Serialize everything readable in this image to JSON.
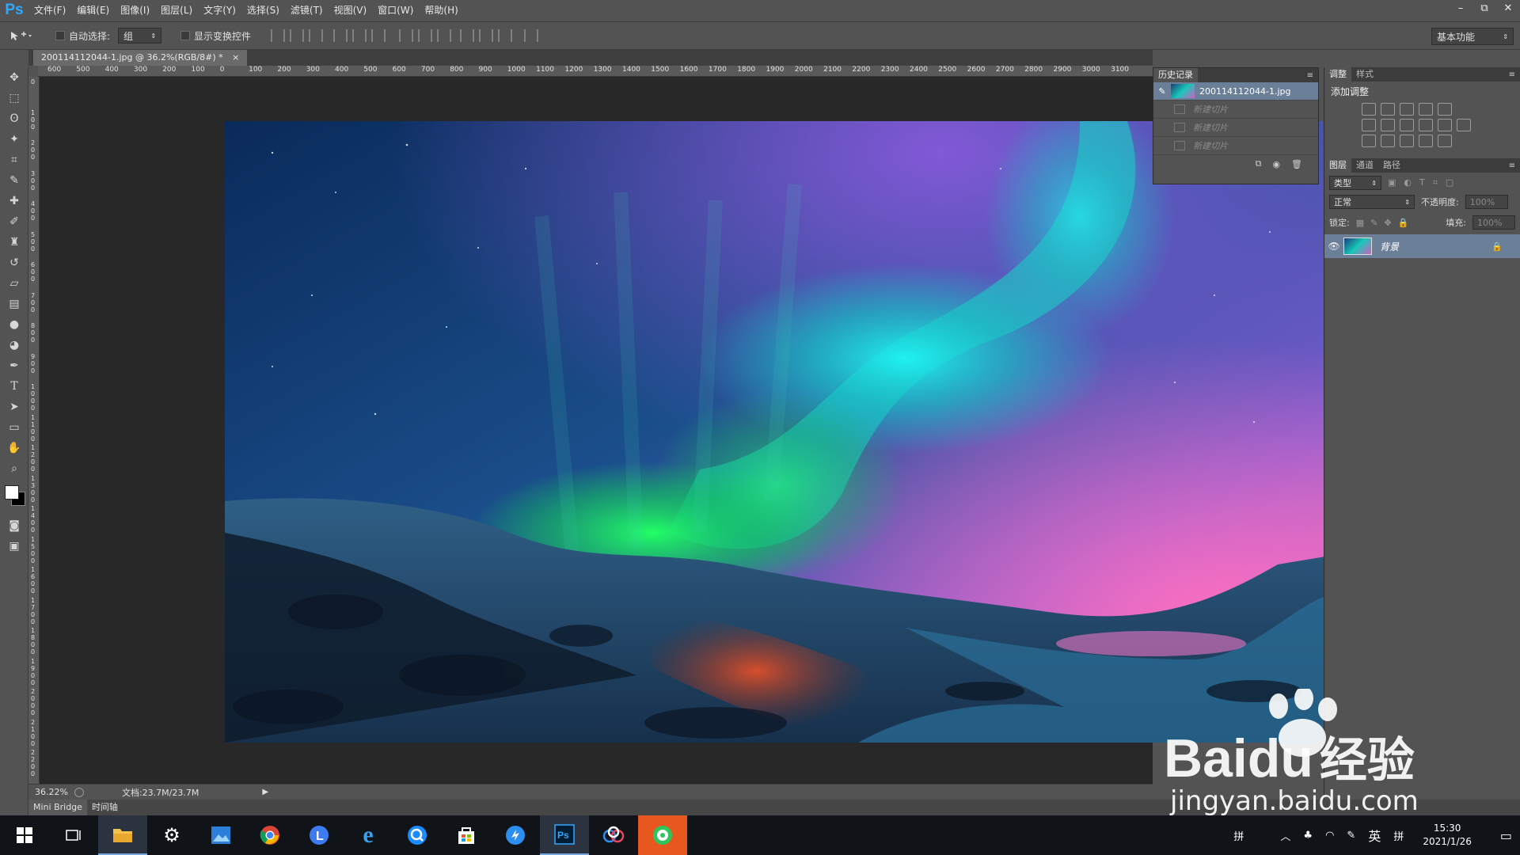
{
  "app": {
    "logo": "Ps",
    "menu": [
      "文件(F)",
      "编辑(E)",
      "图像(I)",
      "图层(L)",
      "文字(Y)",
      "选择(S)",
      "滤镜(T)",
      "视图(V)",
      "窗口(W)",
      "帮助(H)"
    ],
    "window_controls": {
      "minimize": "–",
      "restore": "⧉",
      "close": "✕"
    }
  },
  "options": {
    "auto_select_label": "自动选择:",
    "auto_select_value": "组",
    "show_transform_label": "显示变换控件",
    "workspace": "基本功能"
  },
  "document": {
    "tab_title": "200114112044-1.jpg @ 36.2%(RGB/8#) *",
    "ruler_top": [
      "600",
      "500",
      "400",
      "300",
      "200",
      "100",
      "0",
      "100",
      "200",
      "300",
      "400",
      "500",
      "600",
      "700",
      "800",
      "900",
      "1000",
      "1100",
      "1200",
      "1300",
      "1400",
      "1500",
      "1600",
      "1700",
      "1800",
      "1900",
      "2000",
      "2100",
      "2200",
      "2300",
      "2400",
      "2500",
      "2600",
      "2700",
      "2800",
      "2900",
      "3000",
      "3100"
    ],
    "ruler_left": [
      "0",
      "100",
      "200",
      "300",
      "400",
      "500",
      "600",
      "700",
      "800",
      "900",
      "1000",
      "1100",
      "1200",
      "1300",
      "1400",
      "1500",
      "1600",
      "1700",
      "1800",
      "1900",
      "2000",
      "2100",
      "2200"
    ]
  },
  "status": {
    "zoom": "36.22%",
    "doc_info": "文档:23.7M/23.7M"
  },
  "bottom_tabs": [
    "Mini Bridge",
    "时间轴"
  ],
  "history": {
    "tab": "历史记录",
    "snapshot": "200114112044-1.jpg",
    "steps": [
      "新建切片",
      "新建切片",
      "新建切片"
    ]
  },
  "adjustments": {
    "tabs": [
      "调整",
      "样式"
    ],
    "title": "添加调整"
  },
  "layers": {
    "tabs": [
      "图层",
      "通道",
      "路径"
    ],
    "filter_kind": "类型",
    "blend_mode": "正常",
    "opacity_label": "不透明度:",
    "opacity_value": "100%",
    "lock_label": "锁定:",
    "fill_label": "填充:",
    "fill_value": "100%",
    "items": [
      {
        "name": "背景"
      }
    ]
  },
  "watermark": {
    "brand_a": "Bai",
    "brand_b": "du",
    "brand_cn": "经验",
    "url": "jingyan.baidu.com"
  },
  "taskbar": {
    "apps": [
      "windows-start",
      "task-view",
      "file-explorer",
      "settings",
      "photos",
      "chrome",
      "app-l",
      "internet-explorer",
      "search-app",
      "store",
      "swift-app",
      "photoshop",
      "baidu-netdisk",
      "chat-app"
    ],
    "tray_text_1": "拼",
    "tray_lang": "英",
    "tray_text_2": "拼",
    "time": "15:30",
    "date": "2021/1/26"
  }
}
